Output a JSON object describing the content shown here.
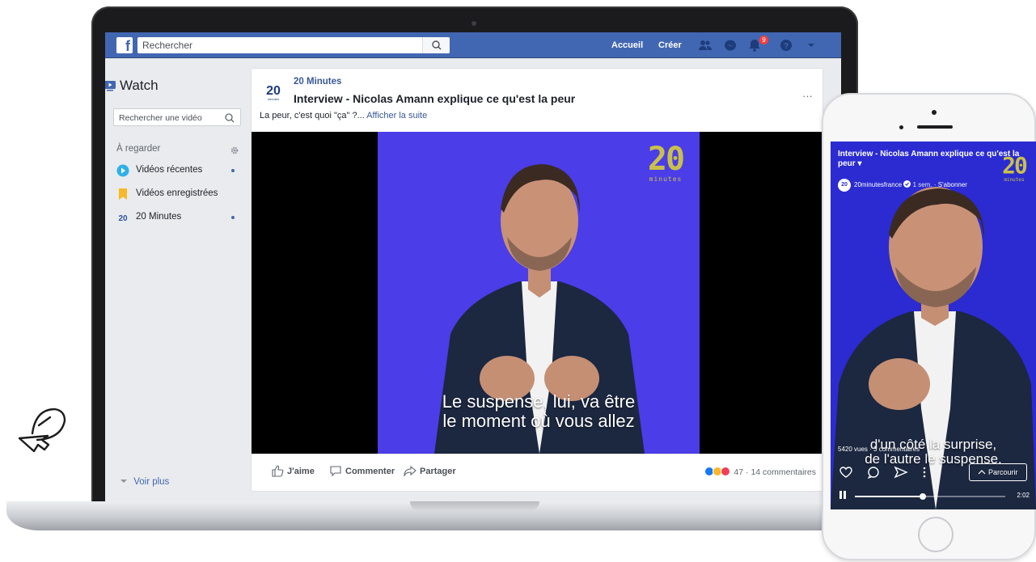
{
  "search": {
    "placeholder": "Rechercher"
  },
  "topnav": {
    "home": "Accueil",
    "create": "Créer",
    "notif_count": "9"
  },
  "sidebar": {
    "title": "Watch",
    "search_placeholder": "Rechercher une vidéo",
    "heading": "À regarder",
    "items": [
      {
        "label": "Vidéos récentes",
        "icon": "play-icon",
        "dot": true
      },
      {
        "label": "Vidéos enregistrées",
        "icon": "bookmark-icon",
        "dot": false
      },
      {
        "label": "20 Minutes",
        "icon": "page-logo-icon",
        "dot": true
      }
    ],
    "more": "Voir plus"
  },
  "post": {
    "page_name": "20 Minutes",
    "title": "Interview - Nicolas Amann explique ce qu'est la peur",
    "text": "La peur, c'est quoi \"ça\" ?...",
    "see_more": "Afficher la suite",
    "subtitle_line1": "Le suspense, lui, va être",
    "subtitle_line2": "le moment où vous allez",
    "watermark": "20",
    "watermark_sub": "minutes",
    "like": "J'aime",
    "comment": "Commenter",
    "share": "Partager",
    "reactions_count": "47",
    "comments_count": "14 commentaires"
  },
  "phone": {
    "title": "Interview - Nicolas Amann explique ce qu'est la peur ▾",
    "account": "20minutesfrance",
    "time_ago": "1 sem.",
    "subscribe": "S'abonner",
    "views": "5420 vues · 3 commentaires",
    "subtitle_line1": "d'un côté la surprise,",
    "subtitle_line2": "de l'autre le suspense.",
    "browse": "Parcourir",
    "duration": "2:02",
    "progress": 0.45
  },
  "colors": {
    "fb_blue": "#4267b2",
    "video_bg": "#4b3de8",
    "link": "#385898"
  }
}
